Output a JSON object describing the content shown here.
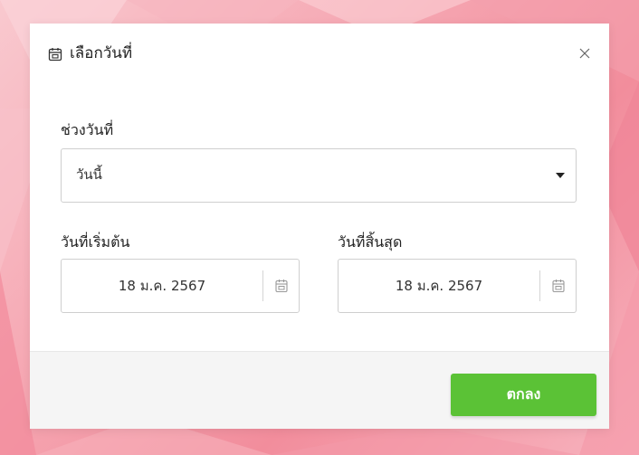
{
  "dialog": {
    "title": "เลือกวันที่",
    "title_icon": "calendar-icon",
    "close_icon": "close-icon"
  },
  "range": {
    "label": "ช่วงวันที่",
    "selected": "วันนี้"
  },
  "start_date": {
    "label": "วันที่เริ่มต้น",
    "value": "18 ม.ค. 2567"
  },
  "end_date": {
    "label": "วันที่สิ้นสุด",
    "value": "18 ม.ค. 2567"
  },
  "footer": {
    "ok_label": "ตกลง"
  },
  "colors": {
    "accent": "#5bc236",
    "backdrop": "#f6a9b4"
  }
}
